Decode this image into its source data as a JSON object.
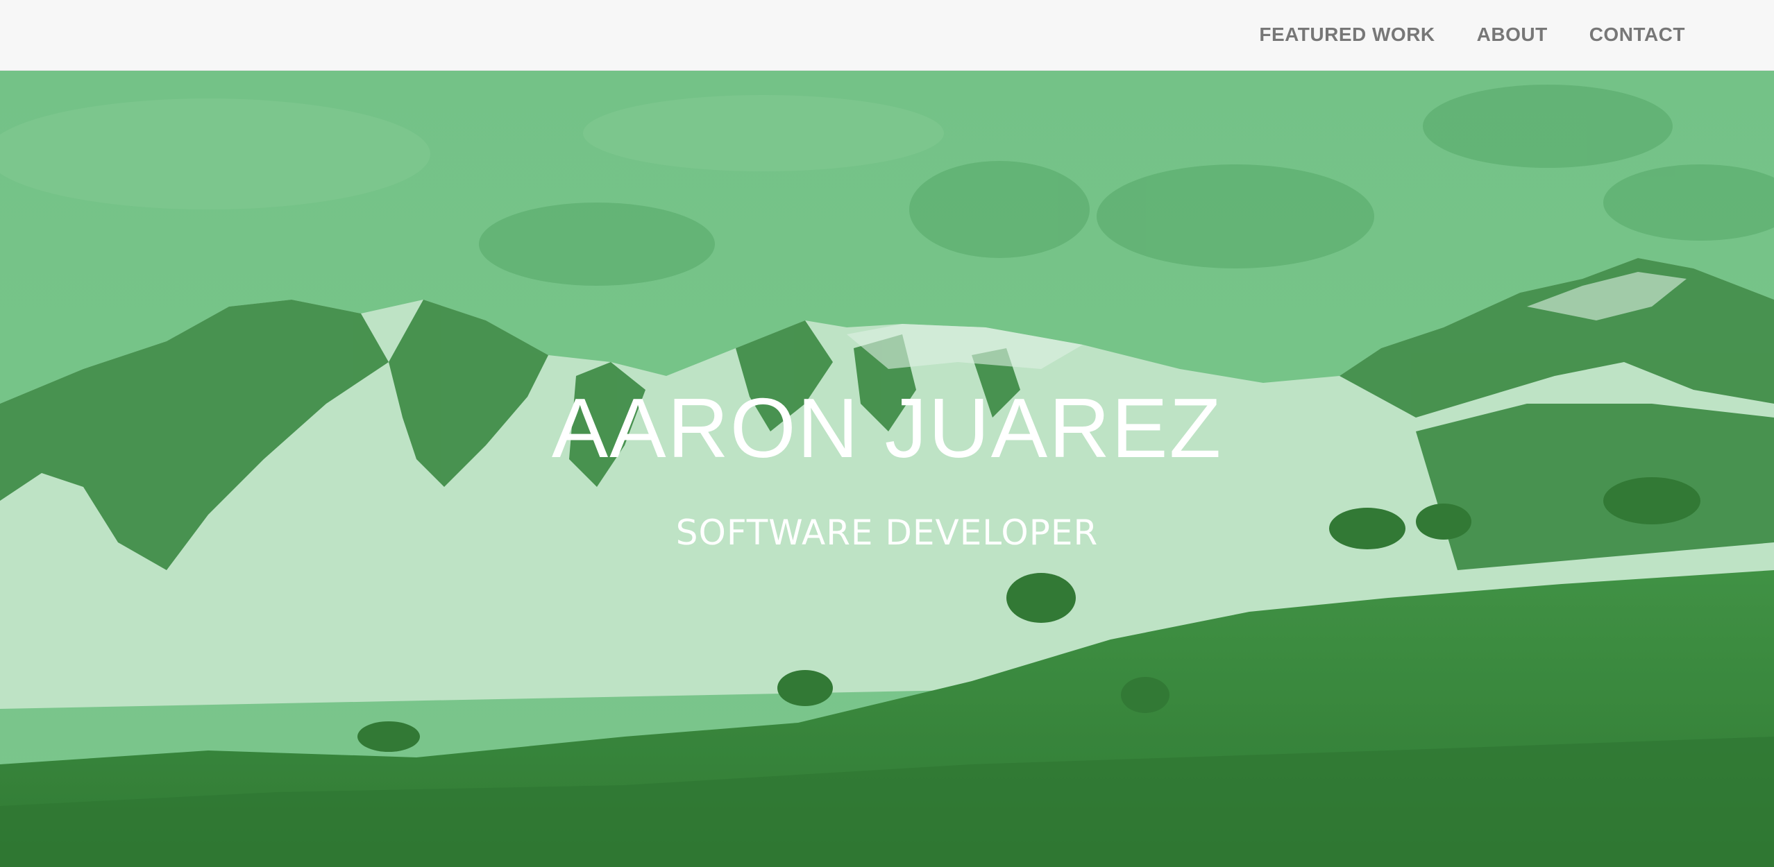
{
  "nav": {
    "items": [
      {
        "label": "FEATURED WORK"
      },
      {
        "label": "ABOUT"
      },
      {
        "label": "CONTACT"
      }
    ]
  },
  "hero": {
    "title": "AARON JUAREZ",
    "subtitle": "SOFTWARE DEVELOPER",
    "image": "mountain-landscape-image",
    "overlay_color": "#48b063"
  },
  "colors": {
    "nav_background": "#f7f7f7",
    "nav_text": "#777777",
    "hero_text": "#ffffff"
  }
}
